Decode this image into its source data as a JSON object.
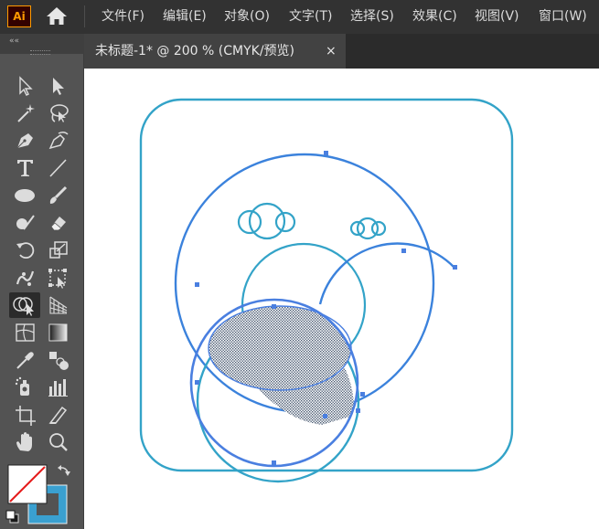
{
  "app": {
    "logo_text": "Ai",
    "accent": "#ff9a00"
  },
  "menu": {
    "items": [
      "文件(F)",
      "编辑(E)",
      "对象(O)",
      "文字(T)",
      "选择(S)",
      "效果(C)",
      "视图(V)",
      "窗口(W)"
    ]
  },
  "document_tab": {
    "label": "未标题-1* @ 200 % (CMYK/预览)",
    "close": "×"
  },
  "toolbar": {
    "collapse": "««",
    "tools": [
      "selection-tool-icon",
      "direct-selection-tool-icon",
      "magic-wand-tool-icon",
      "lasso-tool-icon",
      "pen-tool-icon",
      "curvature-tool-icon",
      "type-tool-icon",
      "line-segment-tool-icon",
      "ellipse-tool-icon",
      "paintbrush-tool-icon",
      "shaper-tool-icon",
      "eraser-tool-icon",
      "rotate-tool-icon",
      "scale-tool-icon",
      "puppet-warp-tool-icon",
      "free-transform-tool-icon",
      "shape-builder-tool-icon",
      "perspective-grid-tool-icon",
      "mesh-tool-icon",
      "gradient-tool-icon",
      "eyedropper-tool-icon",
      "blend-tool-icon",
      "symbol-sprayer-tool-icon",
      "column-graph-tool-icon",
      "artboard-tool-icon",
      "slice-tool-icon",
      "hand-tool-icon",
      "zoom-tool-icon"
    ],
    "active_tool": "shape-builder-tool-icon",
    "fill": "none",
    "stroke_color": "#3aa0d0"
  },
  "colors": {
    "stroke_teal": "#33a3c8",
    "stroke_blue": "#3b82dc",
    "selection_blue": "#4a7fe0",
    "hatch": "#4b5b73"
  }
}
